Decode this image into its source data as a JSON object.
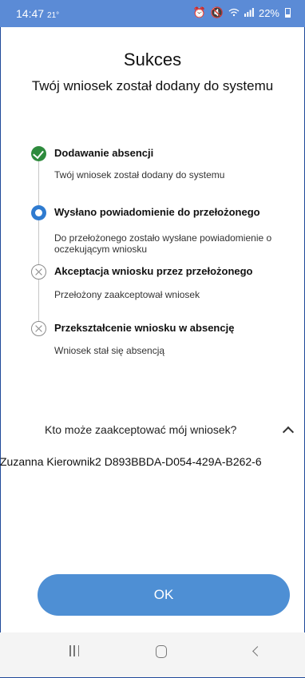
{
  "status_bar": {
    "time": "14:47",
    "temperature": "21°",
    "battery": "22%",
    "icons": [
      "alarm-icon",
      "mute-icon",
      "wifi-icon",
      "signal-icon",
      "battery-icon"
    ]
  },
  "header": {
    "title": "Sukces",
    "subtitle": "Twój wniosek został dodany do systemu"
  },
  "steps": [
    {
      "state": "done",
      "title": "Dodawanie absencji",
      "description": "Twój wniosek został dodany do systemu"
    },
    {
      "state": "current",
      "title": "Wysłano powiadomienie do  przełożonego",
      "description": "Do przełożonego zostało wysłane powiadomienie o oczekującym wniosku"
    },
    {
      "state": "pending",
      "title": "Akceptacja wniosku przez przełożonego",
      "description": "Przełożony zaakceptował wniosek"
    },
    {
      "state": "pending",
      "title": "Przekształcenie wniosku w  absencję",
      "description": "Wniosek stał się absencją"
    }
  ],
  "approvers": {
    "question": "Kto może zaakceptować mój wniosek?",
    "expanded": true,
    "value": "Zuzanna Kierownik2  D893BBDA-D054-429A-B262-6"
  },
  "ok_label": "OK",
  "colors": {
    "status_bar": "#5b8bd6",
    "accent": "#4e8fd4",
    "done": "#2e8b3d",
    "current": "#2f7bd0"
  }
}
